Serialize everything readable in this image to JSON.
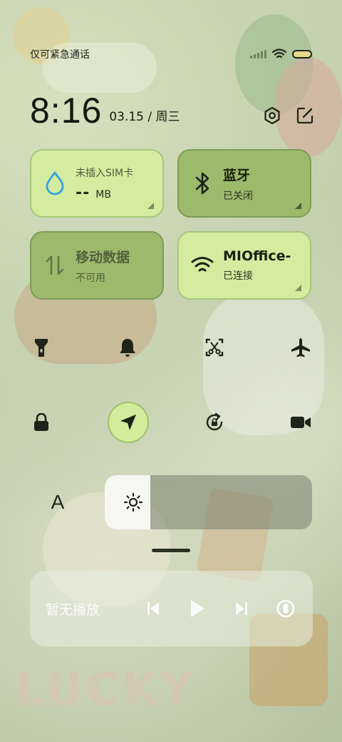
{
  "status_bar": {
    "carrier_text": "仅可紧急通话",
    "icons": [
      "signal-icon",
      "wifi-icon",
      "battery-icon"
    ],
    "battery_color": "#e6d88a"
  },
  "header": {
    "time": "8:16",
    "date": "03.15 / 周三",
    "actions": [
      "settings-icon",
      "edit-icon"
    ]
  },
  "tiles": {
    "sim": {
      "title": "未插入SIM卡",
      "value": "--",
      "unit": "MB",
      "icon": "water-drop-icon"
    },
    "bluetooth": {
      "title": "蓝牙",
      "status": "已关闭",
      "icon": "bluetooth-icon"
    },
    "mobile_data": {
      "title": "移动数据",
      "status": "不可用",
      "icon": "data-arrows-icon"
    },
    "wifi": {
      "title": "MIOffice-",
      "status": "已连接",
      "icon": "wifi-icon"
    }
  },
  "toggles_row1": [
    "flashlight-icon",
    "bell-icon",
    "screenshot-icon",
    "airplane-icon"
  ],
  "toggles_row2": [
    "lock-icon",
    "location-icon",
    "rotation-lock-icon",
    "video-camera-icon"
  ],
  "brightness": {
    "auto_label": "A",
    "level": 0.22,
    "icon": "sun-icon"
  },
  "media": {
    "title": "暂无播放",
    "controls": [
      "previous-icon",
      "play-icon",
      "next-icon",
      "cast-icon"
    ]
  },
  "colors": {
    "tile_light": "#d3ec9f",
    "tile_dark": "#9cba6c",
    "accent_blue": "#3aa0e0"
  }
}
